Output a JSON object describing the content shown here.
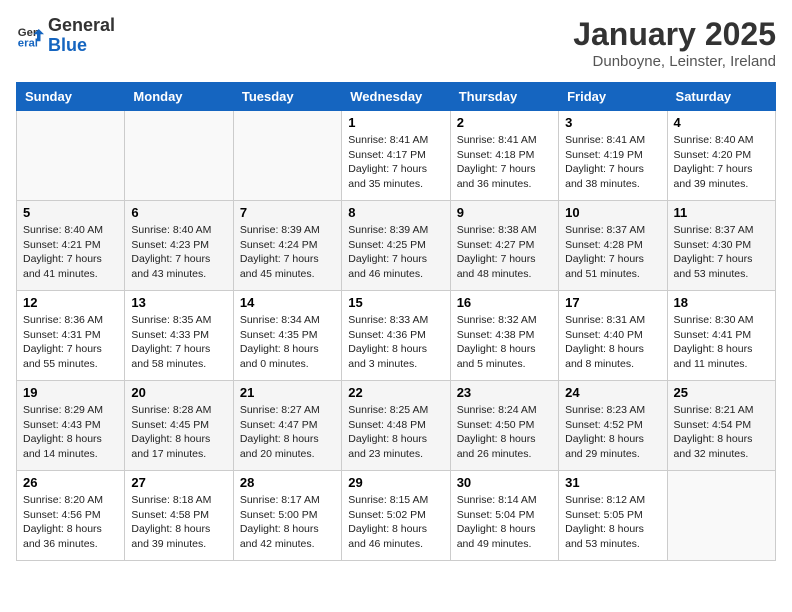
{
  "logo": {
    "general": "General",
    "blue": "Blue"
  },
  "title": "January 2025",
  "subtitle": "Dunboyne, Leinster, Ireland",
  "days_of_week": [
    "Sunday",
    "Monday",
    "Tuesday",
    "Wednesday",
    "Thursday",
    "Friday",
    "Saturday"
  ],
  "weeks": [
    [
      {
        "day": "",
        "content": ""
      },
      {
        "day": "",
        "content": ""
      },
      {
        "day": "",
        "content": ""
      },
      {
        "day": "1",
        "content": "Sunrise: 8:41 AM\nSunset: 4:17 PM\nDaylight: 7 hours\nand 35 minutes."
      },
      {
        "day": "2",
        "content": "Sunrise: 8:41 AM\nSunset: 4:18 PM\nDaylight: 7 hours\nand 36 minutes."
      },
      {
        "day": "3",
        "content": "Sunrise: 8:41 AM\nSunset: 4:19 PM\nDaylight: 7 hours\nand 38 minutes."
      },
      {
        "day": "4",
        "content": "Sunrise: 8:40 AM\nSunset: 4:20 PM\nDaylight: 7 hours\nand 39 minutes."
      }
    ],
    [
      {
        "day": "5",
        "content": "Sunrise: 8:40 AM\nSunset: 4:21 PM\nDaylight: 7 hours\nand 41 minutes."
      },
      {
        "day": "6",
        "content": "Sunrise: 8:40 AM\nSunset: 4:23 PM\nDaylight: 7 hours\nand 43 minutes."
      },
      {
        "day": "7",
        "content": "Sunrise: 8:39 AM\nSunset: 4:24 PM\nDaylight: 7 hours\nand 45 minutes."
      },
      {
        "day": "8",
        "content": "Sunrise: 8:39 AM\nSunset: 4:25 PM\nDaylight: 7 hours\nand 46 minutes."
      },
      {
        "day": "9",
        "content": "Sunrise: 8:38 AM\nSunset: 4:27 PM\nDaylight: 7 hours\nand 48 minutes."
      },
      {
        "day": "10",
        "content": "Sunrise: 8:37 AM\nSunset: 4:28 PM\nDaylight: 7 hours\nand 51 minutes."
      },
      {
        "day": "11",
        "content": "Sunrise: 8:37 AM\nSunset: 4:30 PM\nDaylight: 7 hours\nand 53 minutes."
      }
    ],
    [
      {
        "day": "12",
        "content": "Sunrise: 8:36 AM\nSunset: 4:31 PM\nDaylight: 7 hours\nand 55 minutes."
      },
      {
        "day": "13",
        "content": "Sunrise: 8:35 AM\nSunset: 4:33 PM\nDaylight: 7 hours\nand 58 minutes."
      },
      {
        "day": "14",
        "content": "Sunrise: 8:34 AM\nSunset: 4:35 PM\nDaylight: 8 hours\nand 0 minutes."
      },
      {
        "day": "15",
        "content": "Sunrise: 8:33 AM\nSunset: 4:36 PM\nDaylight: 8 hours\nand 3 minutes."
      },
      {
        "day": "16",
        "content": "Sunrise: 8:32 AM\nSunset: 4:38 PM\nDaylight: 8 hours\nand 5 minutes."
      },
      {
        "day": "17",
        "content": "Sunrise: 8:31 AM\nSunset: 4:40 PM\nDaylight: 8 hours\nand 8 minutes."
      },
      {
        "day": "18",
        "content": "Sunrise: 8:30 AM\nSunset: 4:41 PM\nDaylight: 8 hours\nand 11 minutes."
      }
    ],
    [
      {
        "day": "19",
        "content": "Sunrise: 8:29 AM\nSunset: 4:43 PM\nDaylight: 8 hours\nand 14 minutes."
      },
      {
        "day": "20",
        "content": "Sunrise: 8:28 AM\nSunset: 4:45 PM\nDaylight: 8 hours\nand 17 minutes."
      },
      {
        "day": "21",
        "content": "Sunrise: 8:27 AM\nSunset: 4:47 PM\nDaylight: 8 hours\nand 20 minutes."
      },
      {
        "day": "22",
        "content": "Sunrise: 8:25 AM\nSunset: 4:48 PM\nDaylight: 8 hours\nand 23 minutes."
      },
      {
        "day": "23",
        "content": "Sunrise: 8:24 AM\nSunset: 4:50 PM\nDaylight: 8 hours\nand 26 minutes."
      },
      {
        "day": "24",
        "content": "Sunrise: 8:23 AM\nSunset: 4:52 PM\nDaylight: 8 hours\nand 29 minutes."
      },
      {
        "day": "25",
        "content": "Sunrise: 8:21 AM\nSunset: 4:54 PM\nDaylight: 8 hours\nand 32 minutes."
      }
    ],
    [
      {
        "day": "26",
        "content": "Sunrise: 8:20 AM\nSunset: 4:56 PM\nDaylight: 8 hours\nand 36 minutes."
      },
      {
        "day": "27",
        "content": "Sunrise: 8:18 AM\nSunset: 4:58 PM\nDaylight: 8 hours\nand 39 minutes."
      },
      {
        "day": "28",
        "content": "Sunrise: 8:17 AM\nSunset: 5:00 PM\nDaylight: 8 hours\nand 42 minutes."
      },
      {
        "day": "29",
        "content": "Sunrise: 8:15 AM\nSunset: 5:02 PM\nDaylight: 8 hours\nand 46 minutes."
      },
      {
        "day": "30",
        "content": "Sunrise: 8:14 AM\nSunset: 5:04 PM\nDaylight: 8 hours\nand 49 minutes."
      },
      {
        "day": "31",
        "content": "Sunrise: 8:12 AM\nSunset: 5:05 PM\nDaylight: 8 hours\nand 53 minutes."
      },
      {
        "day": "",
        "content": ""
      }
    ]
  ]
}
